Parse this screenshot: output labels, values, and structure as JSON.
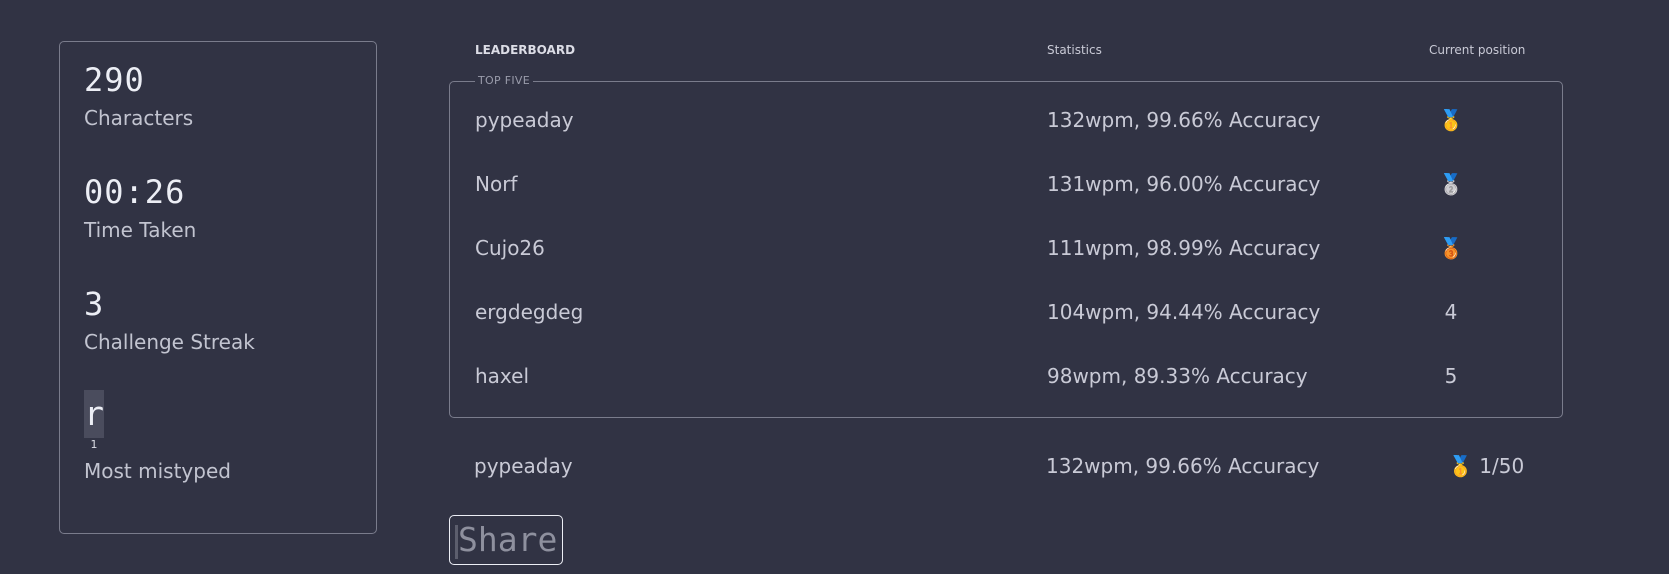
{
  "stats": {
    "characters": {
      "value": "290",
      "label": "Characters"
    },
    "time": {
      "value": "00:26",
      "label": "Time Taken"
    },
    "streak": {
      "value": "3",
      "label": "Challenge Streak"
    },
    "mistyped": {
      "key": "r",
      "count": "1",
      "label": "Most mistyped"
    }
  },
  "leaderboard": {
    "header": {
      "name": "LEADERBOARD",
      "stats": "Statistics",
      "position": "Current position"
    },
    "legend": "TOP FIVE",
    "rows": [
      {
        "name": "pypeaday",
        "stats": "132wpm, 99.66% Accuracy",
        "position": "🥇",
        "medal": "gold-medal"
      },
      {
        "name": "Norf",
        "stats": "131wpm, 96.00% Accuracy",
        "position": "🥈",
        "medal": "silver-medal"
      },
      {
        "name": "Cujo26",
        "stats": "111wpm, 98.99% Accuracy",
        "position": "🥉",
        "medal": "bronze-medal"
      },
      {
        "name": "ergdegdeg",
        "stats": "104wpm, 94.44% Accuracy",
        "position": "4"
      },
      {
        "name": "haxel",
        "stats": "98wpm, 89.33% Accuracy",
        "position": "5"
      }
    ],
    "current": {
      "name": "pypeaday",
      "stats": "132wpm, 99.66% Accuracy",
      "medal": "🥇",
      "rank": "1/50"
    }
  },
  "share": {
    "label": "Share"
  }
}
